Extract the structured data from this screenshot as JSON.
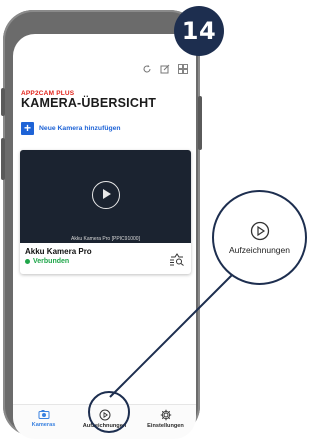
{
  "badge": "14",
  "header": {
    "icons": [
      "refresh-icon",
      "edit-icon",
      "grid-icon"
    ],
    "brand": "APP2CAM PLUS",
    "title": "KAMERA-ÜBERSICHT"
  },
  "add_camera": {
    "icon": "plus-icon",
    "label": "Neue Kamera hinzufügen"
  },
  "camera_card": {
    "preview_caption": "Akku Kamera Pro [PPIC91000]",
    "name": "Akku Kamera Pro",
    "status": "Verbunden",
    "status_color": "#1fa64a",
    "detail_icon": "camera-settings-icon"
  },
  "nav": {
    "items": [
      {
        "label": "Kameras",
        "icon": "camera-icon",
        "active": true
      },
      {
        "label": "Aufzeichnungen",
        "icon": "play-circle-icon",
        "active": false
      },
      {
        "label": "Einstellungen",
        "icon": "gear-icon",
        "active": false
      }
    ]
  },
  "callout": {
    "label": "Aufzeichnungen",
    "icon": "play-circle-icon"
  },
  "colors": {
    "accent": "#1e63d6",
    "brand": "#e2231a",
    "badge": "#1d2e4f"
  }
}
